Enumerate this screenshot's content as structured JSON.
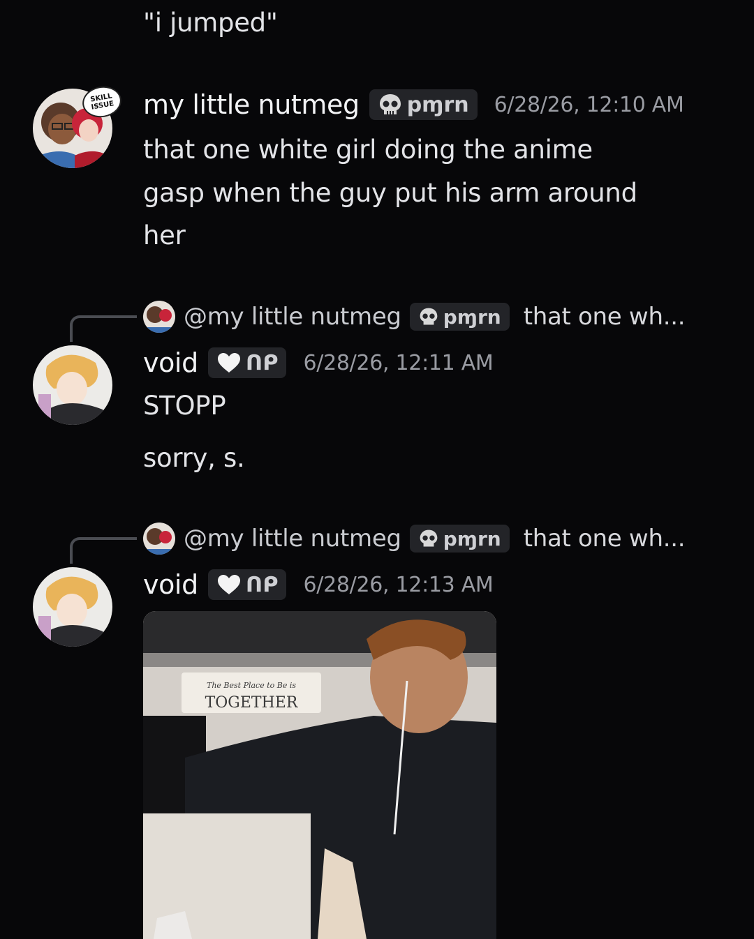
{
  "top_message": {
    "text": "\"i jumped\""
  },
  "messages": [
    {
      "username": "my little nutmeg",
      "tag_label": "pɱrn",
      "tag_icon": "skull-icon",
      "timestamp": "6/28/26, 12:10 AM",
      "avatar_badge": "SKILL ISSUE",
      "lines": [
        "that one white girl doing the anime",
        "gasp when the guy put his arm around",
        "her"
      ]
    },
    {
      "reply": {
        "name": "@my little nutmeg",
        "tag_label": "pɱrn",
        "snippet": "that one wh..."
      },
      "username": "void",
      "tag_label": "ᑎᑭ",
      "tag_icon": "white-heart-icon",
      "timestamp": "6/28/26, 12:11 AM",
      "lines": [
        "STOPP",
        "sorry, s."
      ]
    },
    {
      "reply": {
        "name": "@my little nutmeg",
        "tag_label": "pɱrn",
        "snippet": "that one wh..."
      },
      "username": "void",
      "tag_label": "ᑎᑭ",
      "tag_icon": "white-heart-icon",
      "timestamp": "6/28/26, 12:13 AM",
      "attachment": {
        "type": "video-gif",
        "sign_line1": "The Best Place to Be is",
        "sign_line2": "TOGETHER"
      }
    }
  ],
  "colors": {
    "background": "#070709",
    "text": "#e3e4e8",
    "muted": "#9a9ca3",
    "tag_bg": "#232428"
  }
}
